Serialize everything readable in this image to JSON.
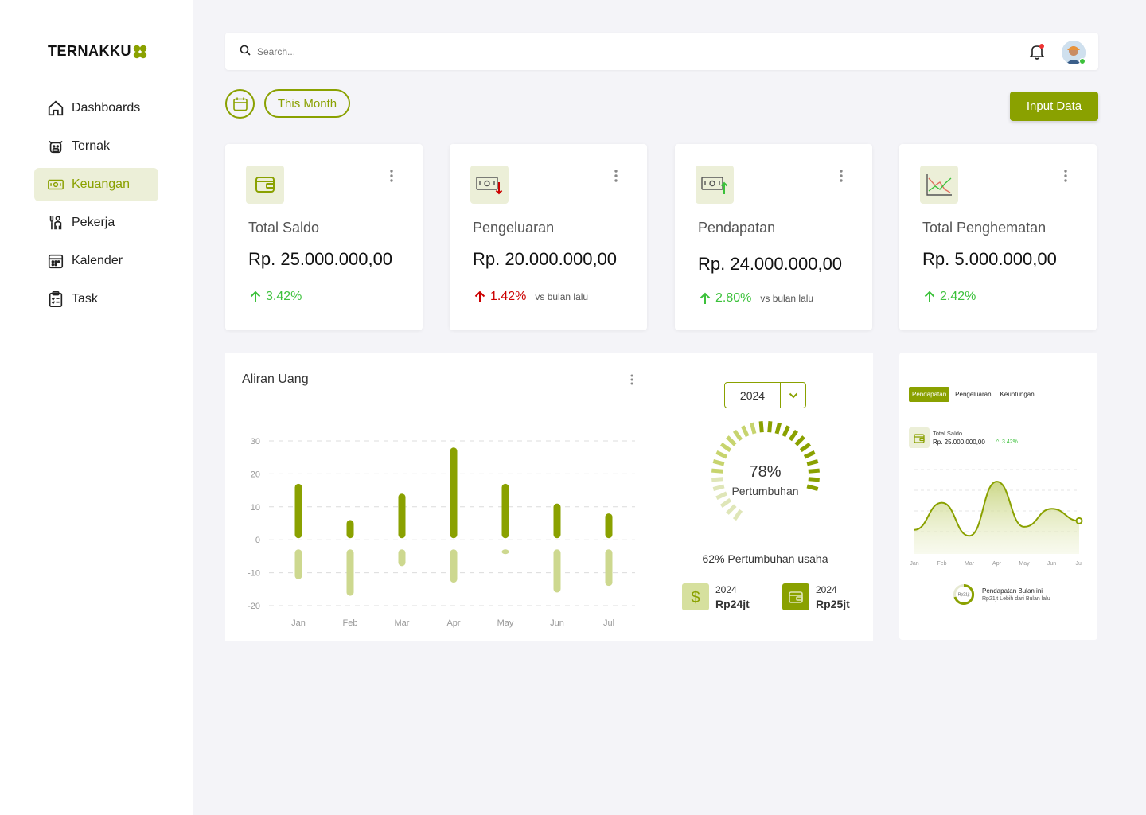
{
  "brand": {
    "name": "TERNAKKU",
    "accent": "#8aa100",
    "accent_light": "#ecefd8",
    "sidebar_bg": "#ffffff"
  },
  "sidebar": {
    "items": [
      {
        "label": "Dashboards",
        "icon": "home-icon",
        "active": false
      },
      {
        "label": "Ternak",
        "icon": "cow-icon",
        "active": false
      },
      {
        "label": "Keuangan",
        "icon": "money-icon",
        "active": true
      },
      {
        "label": "Pekerja",
        "icon": "worker-icon",
        "active": false
      },
      {
        "label": "Kalender",
        "icon": "calendar-icon",
        "active": false
      },
      {
        "label": "Task",
        "icon": "clipboard-icon",
        "active": false
      }
    ]
  },
  "header": {
    "search_placeholder": "Search..."
  },
  "filters": {
    "period_label": "This Month",
    "input_button": "Input Data"
  },
  "cards": [
    {
      "label": "Total Saldo",
      "value": "Rp. 25.000.000,00",
      "change": "3.42%",
      "direction": "up",
      "color": "#3cc13b",
      "vs": "",
      "icon": "wallet-icon"
    },
    {
      "label": "Pengeluaran",
      "value": "Rp. 20.000.000,00",
      "change": "1.42%",
      "direction": "up",
      "color": "#cc0000",
      "vs": "vs bulan lalu",
      "icon": "money-down-icon"
    },
    {
      "label": "Pendapatan",
      "value": "Rp. 24.000.000,00",
      "change": "2.80%",
      "direction": "up",
      "color": "#3cc13b",
      "vs": "vs bulan lalu",
      "icon": "money-up-icon"
    },
    {
      "label": "Total Penghematan",
      "value": "Rp. 5.000.000,00",
      "change": "2.42%",
      "direction": "up",
      "color": "#3cc13b",
      "vs": "",
      "icon": "chart-icon"
    }
  ],
  "flow": {
    "title": "Aliran Uang"
  },
  "chart_data": [
    {
      "type": "bar",
      "title": "Aliran Uang",
      "categories": [
        "Jan",
        "Feb",
        "Mar",
        "Apr",
        "May",
        "Jun",
        "Jul"
      ],
      "y_ticks": [
        30,
        20,
        10,
        0,
        -10,
        -20
      ],
      "ylim": [
        -20,
        30
      ],
      "grid": true,
      "series": [
        {
          "values": [
            17,
            6,
            14,
            28,
            17,
            11,
            8
          ],
          "color": "#8aa100"
        },
        {
          "values": [
            -12,
            -17,
            -8,
            -13,
            -4,
            -16,
            -14
          ],
          "color": "#cdd88f"
        }
      ]
    },
    {
      "type": "area",
      "categories": [
        "Jan",
        "Feb",
        "Mar",
        "Apr",
        "May",
        "Jun",
        "Jul"
      ],
      "values": [
        8,
        17,
        6,
        24,
        9,
        15,
        11
      ],
      "color": "#8aa100",
      "grid": true
    }
  ],
  "growth": {
    "year": "2024",
    "percent_label": "78%",
    "percent": 78,
    "label": "Pertumbuhan",
    "note": "62% Pertumbuhan usaha",
    "stats": [
      {
        "year": "2024",
        "amount": "Rp24jt",
        "icon": "dollar-icon"
      },
      {
        "year": "2024",
        "amount": "Rp25jt",
        "icon": "wallet-icon"
      }
    ]
  },
  "mini": {
    "tabs": [
      "Pendapatan",
      "Pengeluaran",
      "Keuntungan"
    ],
    "saldo_label": "Total Saldo",
    "saldo_value": "Rp. 25.000.000,00",
    "saldo_change": "3.42%",
    "footer_title": "Pendapatan Bulan ini",
    "footer_sub": "Rp21jt  Lebih dari Bulan lalu",
    "ring_label": "Rp21jt"
  }
}
